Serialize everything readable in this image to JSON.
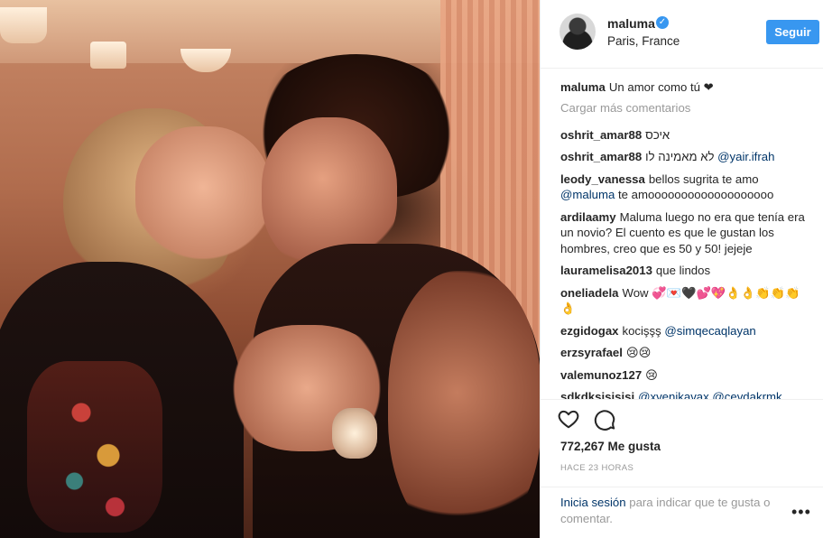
{
  "header": {
    "username": "maluma",
    "verified_icon": "verified-badge-icon",
    "location": "Paris, France",
    "follow_label": "Seguir"
  },
  "caption": {
    "username": "maluma",
    "text": "Un amor como tú ❤"
  },
  "load_more_label": "Cargar más comentarios",
  "comments": [
    {
      "user": "oshrit_amar88",
      "text": "איכס"
    },
    {
      "user": "oshrit_amar88",
      "text": "לא מאמינה לו",
      "mention": "@yair.ifrah"
    },
    {
      "user": "leody_vanessa",
      "text": "bellos sugrita te amo",
      "mention": "@maluma",
      "text2": "te amooooooooooooooooooo"
    },
    {
      "user": "ardilaamy",
      "text": "Maluma luego no era que tenía era un novio? El cuento es que le gustan los hombres, creo que es 50 y 50! jejeje"
    },
    {
      "user": "lauramelisa2013",
      "text": "que lindos"
    },
    {
      "user": "oneliadela",
      "text": "Wow 💞💌🖤💕💖👌👌👏👏👏👌"
    },
    {
      "user": "ezgidogax",
      "text": "kocişşş",
      "mention": "@simqecaqlayan"
    },
    {
      "user": "erzsyrafael",
      "text": "😢😢"
    },
    {
      "user": "valemunoz127",
      "text": "😢"
    },
    {
      "user": "sdkdkşişişişi",
      "mention": "@xvenikavax @cevdakrmk"
    }
  ],
  "actions": {
    "like_icon": "heart-outline-icon",
    "comment_icon": "comment-bubble-icon",
    "likes_text": "772,267 Me gusta",
    "time_text": "HACE 23 HORAS"
  },
  "login": {
    "link_text": "Inicia sesión",
    "rest_text": "para indicar que te gusta o comentar.",
    "more_icon": "more-options-icon",
    "more_glyph": "•••"
  },
  "colors": {
    "accent": "#3897f0",
    "link": "#003569",
    "muted": "#999999",
    "text": "#262626"
  }
}
